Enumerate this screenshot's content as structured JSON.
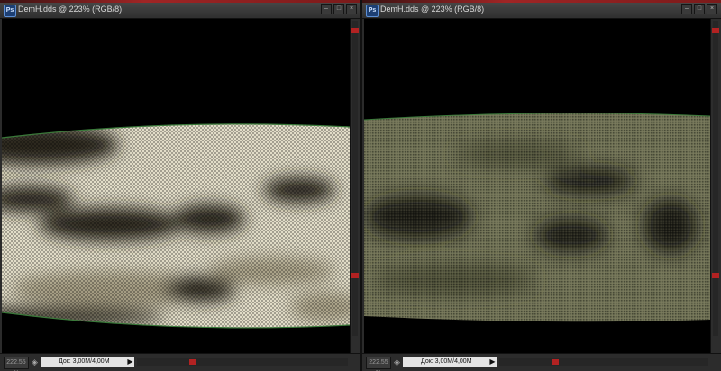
{
  "windows": [
    {
      "title": "DemH.dds @ 223% (RGB/8)",
      "zoom": "222.55 %",
      "doc_info": "Док: 3,00M/4,00M",
      "colors": {
        "light": "#e2ddc8",
        "mid": "#a49c82",
        "dark": "#2a281e",
        "edge": "#3a7a3a"
      }
    },
    {
      "title": "DemH.dds @ 223% (RGB/8)",
      "zoom": "222.55 %",
      "doc_info": "Док: 3,00M/4,00M",
      "colors": {
        "light": "#6f7155",
        "mid": "#4a4c36",
        "dark": "#1a1b12",
        "edge": "#3a7a3a"
      }
    }
  ],
  "icons": {
    "app": "photoshop-icon",
    "minimize": "minimize-icon",
    "maximize": "maximize-icon",
    "close": "close-icon",
    "navigator": "navigator-icon",
    "status_arrow": "play-arrow-icon"
  },
  "accent": "#b22222"
}
